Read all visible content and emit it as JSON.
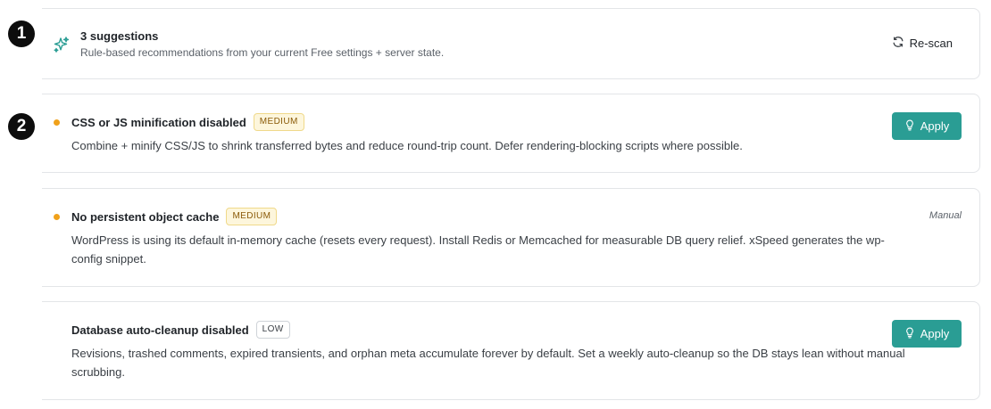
{
  "markers": [
    "1",
    "2"
  ],
  "summary": {
    "icon": "sparkle-icon",
    "title": "3 suggestions",
    "subtitle": "Rule-based recommendations from your current Free settings + server state.",
    "rescan_label": "Re-scan",
    "rescan_icon": "refresh-icon"
  },
  "suggestions": [
    {
      "title": "CSS or JS minification disabled",
      "badge": "MEDIUM",
      "description": "Combine + minify CSS/JS to shrink transferred bytes and reduce round-trip count. Defer rendering-blocking scripts where possible.",
      "action": "Apply",
      "severity_color": "#f0a11a"
    },
    {
      "title": "No persistent object cache",
      "badge": "MEDIUM",
      "description": "WordPress is using its default in-memory cache (resets every request). Install Redis or Memcached for measurable DB query relief. xSpeed generates the wp-config snippet.",
      "action": "Manual",
      "severity_color": "#f0a11a"
    },
    {
      "title": "Database auto-cleanup disabled",
      "badge": "LOW",
      "description": "Revisions, trashed comments, expired transients, and orphan meta accumulate forever by default. Set a weekly auto-cleanup so the DB stays lean without manual scrubbing.",
      "action": "Apply"
    }
  ],
  "colors": {
    "accent": "#2a9d94",
    "medium_dot": "#f0a11a",
    "marker": "#0d0d0d"
  }
}
